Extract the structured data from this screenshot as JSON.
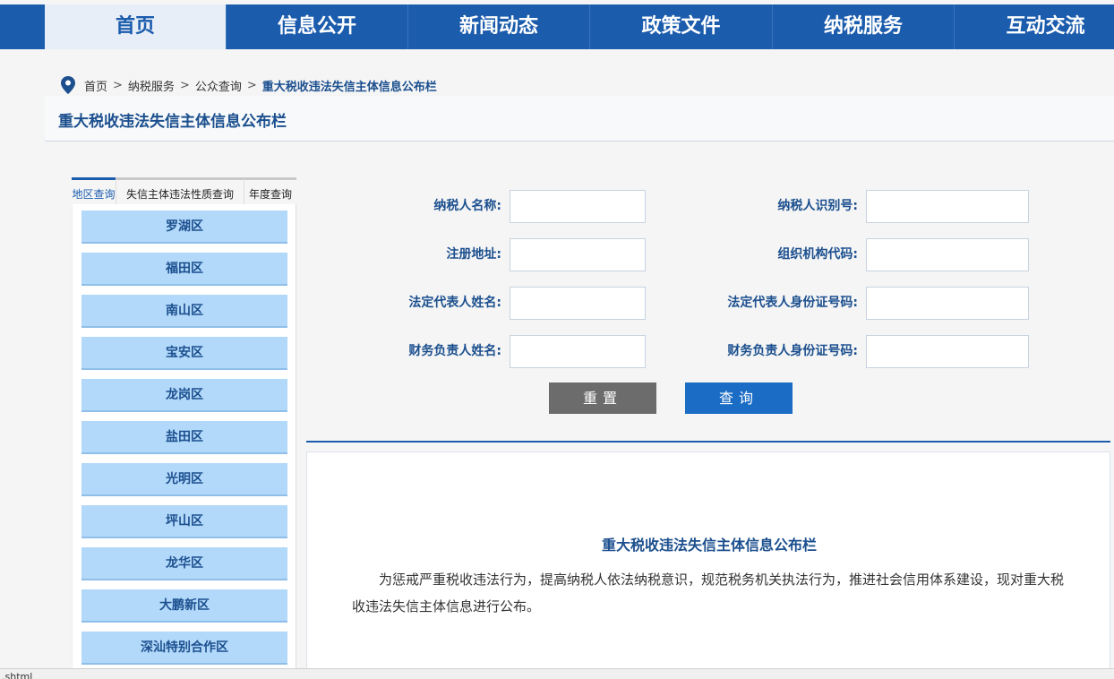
{
  "nav": {
    "items": [
      {
        "label": "首页"
      },
      {
        "label": "信息公开"
      },
      {
        "label": "新闻动态"
      },
      {
        "label": "政策文件"
      },
      {
        "label": "纳税服务"
      },
      {
        "label": "互动交流"
      }
    ]
  },
  "breadcrumb": {
    "items": [
      "首页",
      "纳税服务",
      "公众查询"
    ],
    "separator": ">",
    "current": "重大税收违法失信主体信息公布栏"
  },
  "page_title": "重大税收违法失信主体信息公布栏",
  "sidebar": {
    "tabs": [
      "地区查询",
      "失信主体违法性质查询",
      "年度查询"
    ],
    "districts": [
      "罗湖区",
      "福田区",
      "南山区",
      "宝安区",
      "龙岗区",
      "盐田区",
      "光明区",
      "坪山区",
      "龙华区",
      "大鹏新区",
      "深汕特别合作区"
    ]
  },
  "form": {
    "taxpayer_name": {
      "label": "纳税人名称:",
      "value": ""
    },
    "taxpayer_id": {
      "label": "纳税人识别号:",
      "value": ""
    },
    "reg_address": {
      "label": "注册地址:",
      "value": ""
    },
    "org_code": {
      "label": "组织机构代码:",
      "value": ""
    },
    "legal_rep_name": {
      "label": "法定代表人姓名:",
      "value": ""
    },
    "legal_rep_id": {
      "label": "法定代表人身份证号码:",
      "value": ""
    },
    "finance_name": {
      "label": "财务负责人姓名:",
      "value": ""
    },
    "finance_id": {
      "label": "财务负责人身份证号码:",
      "value": ""
    },
    "reset_label": "重置",
    "search_label": "查询"
  },
  "notice": {
    "title": "重大税收违法失信主体信息公布栏",
    "body": "为惩戒严重税收违法行为，提高纳税人依法纳税意识，规范税务机关执法行为，推进社会信用体系建设，现对重大税收违法失信主体信息进行公布。"
  },
  "statusbar": {
    "text": ".shtml"
  },
  "colors": {
    "brand": "#1b5cad",
    "district_bg": "#b2d8fa",
    "reset_btn": "#6c6c6c",
    "search_btn": "#1b6cc5"
  }
}
